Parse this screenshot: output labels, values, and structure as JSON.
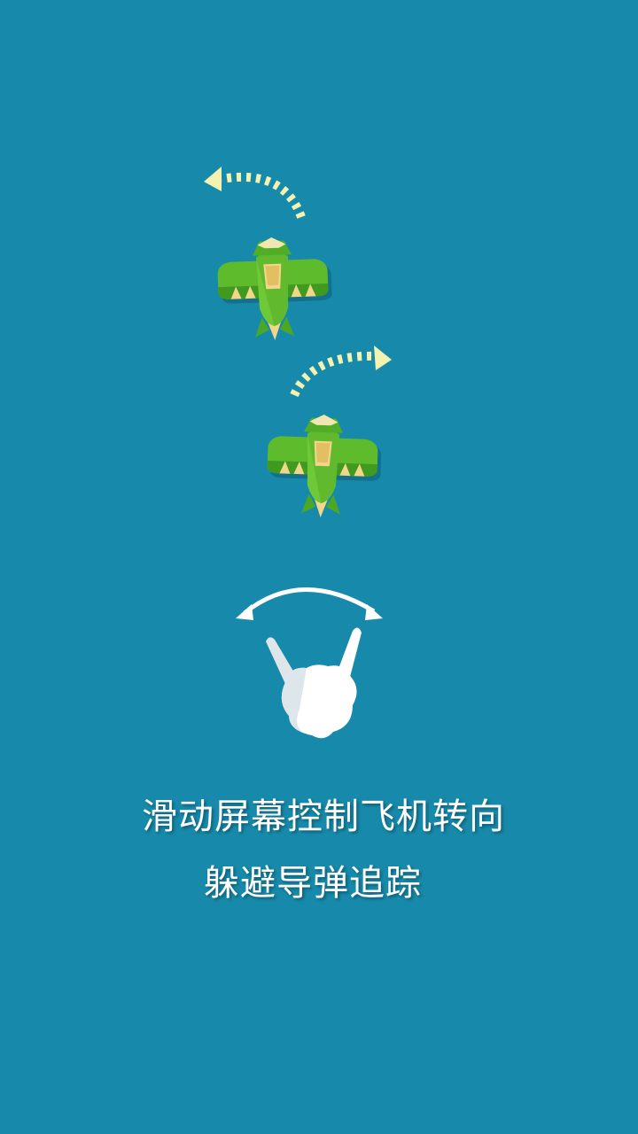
{
  "instructions": {
    "line1": "滑动屏幕控制飞机转向",
    "line2": "躲避导弹追踪"
  },
  "icons": {
    "plane_top": "green-plane-icon",
    "plane_bottom": "green-plane-icon",
    "turn_left_arrow": "dotted-curved-arrow-left-icon",
    "turn_right_arrow": "dotted-curved-arrow-right-icon",
    "swipe_arc": "double-headed-arc-arrow-icon",
    "hand": "swiping-hand-icon"
  },
  "colors": {
    "background": "#178aab",
    "plane_body": "#5dbb2c",
    "plane_accent": "#f2d68a",
    "arrow_dots": "#f3f2b0",
    "text": "#ffffff"
  }
}
